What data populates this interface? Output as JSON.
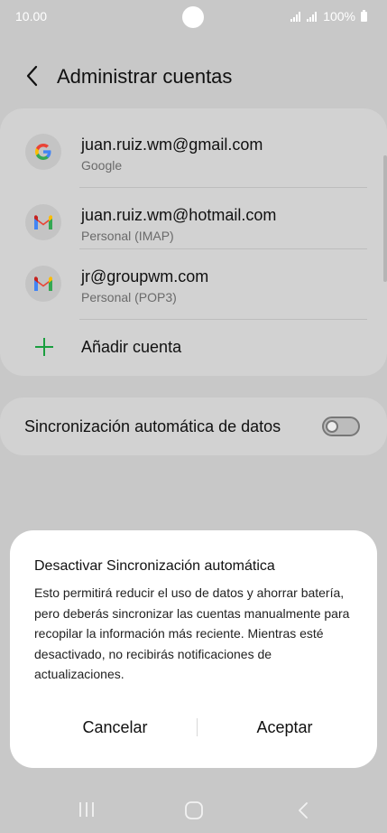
{
  "status_bar": {
    "time": "10.00",
    "battery": "100%"
  },
  "header": {
    "title": "Administrar cuentas"
  },
  "accounts": [
    {
      "email": "juan.ruiz.wm@gmail.com",
      "type": "Google",
      "icon": "google-icon"
    },
    {
      "email": "juan.ruiz.wm@hotmail.com",
      "type": "Personal (IMAP)",
      "icon": "gmail-icon"
    },
    {
      "email": "jr@groupwm.com",
      "type": "Personal (POP3)",
      "icon": "gmail-icon"
    }
  ],
  "add_account": {
    "label": "Añadir cuenta"
  },
  "sync": {
    "label": "Sincronización automática de datos",
    "enabled": false
  },
  "dialog": {
    "title": "Desactivar Sincronización automática",
    "body": "Esto permitirá reducir el uso de datos y ahorrar batería, pero deberás sincronizar las cuentas manualmente para recopilar la información más reciente. Mientras esté desactivado, no recibirás notificaciones de actualizaciones.",
    "cancel_label": "Cancelar",
    "accept_label": "Aceptar"
  },
  "colors": {
    "background": "#c8c8c8",
    "card": "#d2d2d2",
    "dialog": "#ffffff",
    "accent_green": "#1a9e3f"
  }
}
